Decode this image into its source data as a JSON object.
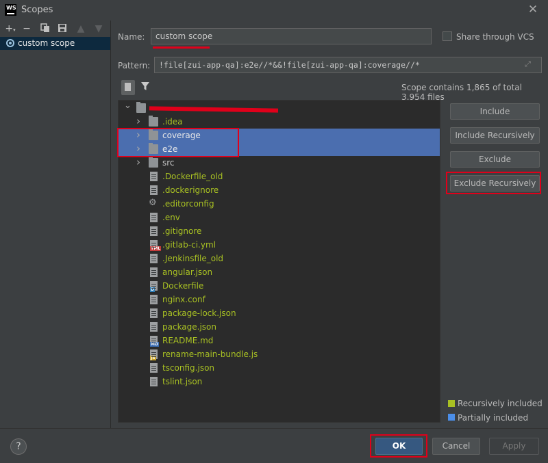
{
  "window": {
    "title": "Scopes"
  },
  "left_toolbar": {
    "add": "+",
    "remove": "−"
  },
  "scopes": [
    {
      "label": "custom scope"
    }
  ],
  "form": {
    "name_label": "Name:",
    "name_value": "custom scope",
    "share_label": "Share through VCS",
    "share_checked": false,
    "pattern_label": "Pattern:",
    "pattern_value": "!file[zui-app-qa]:e2e//*&&!file[zui-app-qa]:coverage//*"
  },
  "scope_summary": "Scope contains 1,865 of total 3,954 files",
  "tree": [
    {
      "label": "",
      "kind": "folder",
      "level": 0,
      "expanded": true,
      "color": "plain"
    },
    {
      "label": ".idea",
      "kind": "folder",
      "level": 1,
      "collapsed": true,
      "color": "green"
    },
    {
      "label": "coverage",
      "kind": "folder",
      "level": 1,
      "collapsed": true,
      "color": "selw",
      "selected": true
    },
    {
      "label": "e2e",
      "kind": "folder",
      "level": 1,
      "collapsed": true,
      "color": "selw",
      "selected": true
    },
    {
      "label": "src",
      "kind": "folder",
      "level": 1,
      "collapsed": true,
      "color": "plain"
    },
    {
      "label": ".Dockerfile_old",
      "kind": "file",
      "level": 1,
      "color": "green"
    },
    {
      "label": ".dockerignore",
      "kind": "file",
      "level": 1,
      "color": "green"
    },
    {
      "label": ".editorconfig",
      "kind": "gear",
      "level": 1,
      "color": "green"
    },
    {
      "label": ".env",
      "kind": "file",
      "level": 1,
      "color": "green"
    },
    {
      "label": ".gitignore",
      "kind": "file",
      "level": 1,
      "color": "green"
    },
    {
      "label": ".gitlab-ci.yml",
      "kind": "yml",
      "level": 1,
      "color": "green"
    },
    {
      "label": ".Jenkinsfile_old",
      "kind": "file",
      "level": 1,
      "color": "green"
    },
    {
      "label": "angular.json",
      "kind": "file",
      "level": 1,
      "color": "green"
    },
    {
      "label": "Dockerfile",
      "kind": "docker",
      "level": 1,
      "color": "green"
    },
    {
      "label": "nginx.conf",
      "kind": "file",
      "level": 1,
      "color": "green"
    },
    {
      "label": "package-lock.json",
      "kind": "file",
      "level": 1,
      "color": "green"
    },
    {
      "label": "package.json",
      "kind": "file",
      "level": 1,
      "color": "green"
    },
    {
      "label": "README.md",
      "kind": "md",
      "level": 1,
      "color": "green"
    },
    {
      "label": "rename-main-bundle.js",
      "kind": "js",
      "level": 1,
      "color": "green"
    },
    {
      "label": "tsconfig.json",
      "kind": "file",
      "level": 1,
      "color": "green"
    },
    {
      "label": "tslint.json",
      "kind": "file",
      "level": 1,
      "color": "green"
    }
  ],
  "actions": {
    "include": "Include",
    "include_recursively": "Include Recursively",
    "exclude": "Exclude",
    "exclude_recursively": "Exclude Recursively"
  },
  "legend": [
    {
      "label": "Recursively included",
      "color": "#a8c023"
    },
    {
      "label": "Partially included",
      "color": "#4b8ee8"
    }
  ],
  "footer": {
    "help": "?",
    "ok": "OK",
    "cancel": "Cancel",
    "apply": "Apply"
  },
  "colors": {
    "highlight": "#e0001a",
    "selection": "#4b6eaf",
    "primary_button": "#365880"
  }
}
